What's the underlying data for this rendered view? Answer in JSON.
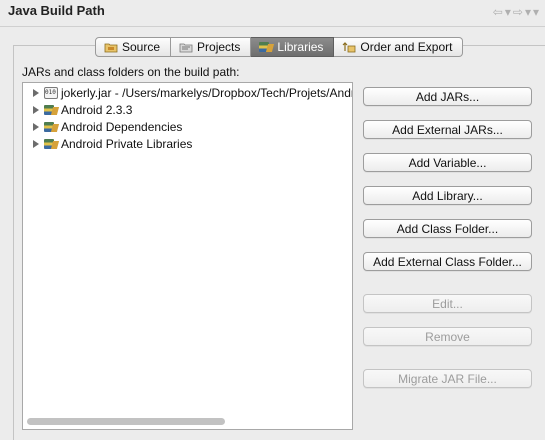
{
  "header": {
    "title": "Java Build Path",
    "nav_back": "⇦",
    "nav_forward": "⇨",
    "nav_menu": "▾"
  },
  "tabs": [
    {
      "label": "Source",
      "icon": "source-folder-icon",
      "active": false
    },
    {
      "label": "Projects",
      "icon": "projects-icon",
      "active": false
    },
    {
      "label": "Libraries",
      "icon": "libraries-icon",
      "active": true
    },
    {
      "label": "Order and Export",
      "icon": "order-export-icon",
      "active": false
    }
  ],
  "section_label": "JARs and class folders on the build path:",
  "tree": [
    {
      "label": "jokerly.jar - /Users/markelys/Dropbox/Tech/Projets/Android",
      "icon": "jar-icon"
    },
    {
      "label": "Android 2.3.3",
      "icon": "library-icon"
    },
    {
      "label": "Android Dependencies",
      "icon": "library-icon"
    },
    {
      "label": "Android Private Libraries",
      "icon": "library-icon"
    }
  ],
  "buttons": [
    {
      "label": "Add JARs...",
      "enabled": true
    },
    {
      "label": "Add External JARs...",
      "enabled": true
    },
    {
      "label": "Add Variable...",
      "enabled": true
    },
    {
      "label": "Add Library...",
      "enabled": true
    },
    {
      "label": "Add Class Folder...",
      "enabled": true
    },
    {
      "label": "Add External Class Folder...",
      "enabled": true
    },
    {
      "label": "Edit...",
      "enabled": false
    },
    {
      "label": "Remove",
      "enabled": false
    },
    {
      "label": "Migrate JAR File...",
      "enabled": false
    }
  ]
}
